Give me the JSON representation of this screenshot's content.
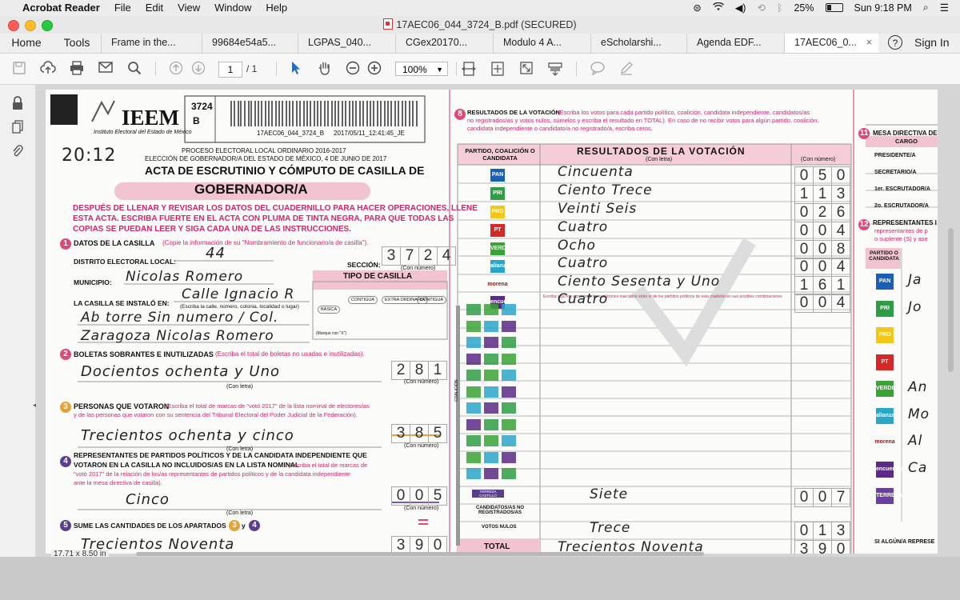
{
  "menubar": {
    "app": "Acrobat Reader",
    "items": [
      "File",
      "Edit",
      "View",
      "Window",
      "Help"
    ],
    "battery": "25%",
    "clock": "Sun 9:18 PM"
  },
  "window": {
    "title": "17AEC06_044_3724_B.pdf (SECURED)"
  },
  "tabs": {
    "home": "Home",
    "tools": "Tools",
    "items": [
      "Frame in the...",
      "99684e54a5...",
      "LGPAS_040...",
      "CGex20170...",
      "Modulo 4 A...",
      "eScholarshi...",
      "Agenda EDF...",
      "17AEC06_0..."
    ],
    "signin": "Sign In"
  },
  "toolbar": {
    "page_current": "1",
    "page_total": "/ 1",
    "zoom": "100%"
  },
  "status": {
    "page_size": "17.71 x 8.50 in"
  },
  "doc": {
    "barcode_num": "3724",
    "barcode_letter": "B",
    "barcode_text": "17AEC06_044_3724_B",
    "barcode_time": "2017/05/11_12:41:45_JE",
    "org_name": "IEEM",
    "org_sub": "Instituto Electoral del Estado de México",
    "time_hw": "20:12",
    "process": "PROCESO ELECTORAL LOCAL ORDINARIO 2016-2017",
    "election": "ELECCIÓN DE GOBERNADOR/A DEL ESTADO DE MÉXICO, 4 DE JUNIO DE 2017",
    "acta_title": "ACTA DE ESCRUTINIO Y CÓMPUTO DE CASILLA DE",
    "banner": "GOBERNADOR/A",
    "instr1": "DESPUÉS DE LLENAR Y REVISAR LOS DATOS DEL CUADERNILLO PARA HACER OPERACIONES, LLENE",
    "instr2": "ESTA ACTA.  ESCRIBA FUERTE EN EL ACTA CON PLUMA DE TINTA NEGRA, PARA QUE TODAS LAS",
    "instr3": "COPIAS SE PUEDAN LEER Y SIGA CADA UNA DE LAS INSTRUCCIONES.",
    "s1_title": "DATOS DE LA CASILLA",
    "s1_hint": "(Copie la información de su \"Nombramiento de funcionario/a de casilla\").",
    "distrito_label": "DISTRITO ELECTORAL LOCAL:",
    "distrito_hw": "44",
    "seccion_label": "SECCIÓN:",
    "seccion_digits": [
      "3",
      "7",
      "2",
      "4"
    ],
    "con_numero": "(Con número)",
    "municipio_label": "MUNICIPIO:",
    "municipio_hw": "Nicolas  Romero",
    "tipo_title": "TIPO DE CASILLA",
    "tipo_opts": [
      "BÁSICA",
      "CONTIGUA",
      "EXTRA ORDINARIA",
      "CONTIGUA"
    ],
    "instalo_label": "LA CASILLA SE INSTALÓ EN:",
    "instalo_hw1": "Calle Ignacio R",
    "instalo_hint": "(Escriba la calle, número, colonia, localidad o lugar)",
    "instalo_hw2": "Ab torre  Sin numero / Col.",
    "instalo_hw3": "Zaragoza  Nicolas Romero",
    "marque": "(Marque con \"X\")",
    "s2_title": "BOLETAS SOBRANTES E INUTILIZADAS",
    "s2_hint": "(Escriba el total de boletas no usadas e inutilizadas).",
    "s2_hw": "Docientos  ochenta y  Uno",
    "s2_digits": [
      "2",
      "8",
      "1"
    ],
    "con_letra": "(Con letra)",
    "s3_title": "PERSONAS QUE VOTARON",
    "s3_hint1": "(Escriba el total de marcas de \"votó 2017\" de la lista nominal de electores/as",
    "s3_hint2": "y de las personas que votaron con su sentencia del Tribunal Electoral del Poder Judicial de la Federación).",
    "s3_hw": "Trecientos  ochenta y  cinco",
    "s3_digits": [
      "3",
      "8",
      "5"
    ],
    "s4_title1": "REPRESENTANTES DE PARTIDOS POLÍTICOS Y DE LA CANDIDATA INDEPENDIENTE QUE",
    "s4_title2": "VOTARON EN LA CASILLA NO INCLUIDOS/AS EN LA LISTA NOMINAL",
    "s4_hint1": "(Escriba el total de marcas de",
    "s4_hint2": "\"votó 2017\" de la relación de los/as representantes de partidos políticos y de la candidata independiente",
    "s4_hint3": "ante la mesa directiva de casilla).",
    "s4_hw": "Cinco",
    "s4_digits": [
      "0",
      "0",
      "5"
    ],
    "s5_title": "SUME LAS CANTIDADES DE LOS APARTADOS",
    "s5_digits": [
      "3",
      "9",
      "0"
    ],
    "s5_hw": "Trecientos  Noventa",
    "equals": "=",
    "y": "y",
    "s8_title": "RESULTADOS DE LA VOTACIÓN",
    "s8_hint1": "(Escriba los votos para cada partido político, coalición, candidata independiente, candidatos/as",
    "s8_hint2": "no registrados/as y votos nulos, súmelos y escriba el resultado en TOTAL). En caso de no recibir votos para algún partido, coalición,",
    "s8_hint3": "candidata  independiente o candidato/a no registrado/a, escriba ceros.",
    "col_partido": "PARTIDO, COALICIÓN O CANDIDATA",
    "col_resultados": "RESULTADOS DE LA VOTACIÓN",
    "col_letra": "(Con letra)",
    "col_numero": "(Con número)",
    "results": [
      {
        "party": "PAN",
        "color": "#1a5fb4",
        "words": "Cincuenta",
        "digits": [
          "0",
          "5",
          "0"
        ]
      },
      {
        "party": "PRI",
        "color": "#2e9e44",
        "words": "Ciento  Trece",
        "digits": [
          "1",
          "1",
          "3"
        ]
      },
      {
        "party": "PRD",
        "color": "#f5c518",
        "words": "Veinti  Seis",
        "digits": [
          "0",
          "2",
          "6"
        ]
      },
      {
        "party": "PT",
        "color": "#d62828",
        "words": "Cuatro",
        "digits": [
          "0",
          "0",
          "4"
        ]
      },
      {
        "party": "VERDE",
        "color": "#3aa335",
        "words": "Ocho",
        "digits": [
          "0",
          "0",
          "8"
        ]
      },
      {
        "party": "alianza",
        "color": "#2aa6c9",
        "words": "Cuatro",
        "digits": [
          "0",
          "0",
          "4"
        ]
      },
      {
        "party": "morena",
        "color": "#8b1a1a",
        "words": "Ciento  Sesenta y  Uno",
        "digits": [
          "1",
          "6",
          "1"
        ]
      },
      {
        "party": "encuentro",
        "color": "#5b2a86",
        "words": "Cuatro",
        "digits": [
          "0",
          "0",
          "4"
        ]
      }
    ],
    "coalicion_note": "Escriba aquí los votos para las coaliciones marcados entre sí de los partidos políticos de esta coalición en sus posibles combinaciones",
    "coalicion_label": "COALICIÓN",
    "terreza_label": "TERREZA CASTILLO",
    "terreza_words": "Siete",
    "terreza_digits": [
      "0",
      "0",
      "7"
    ],
    "no_reg_label": "CANDIDATOS/AS NO REGISTRADOS/AS",
    "nulos_label": "VOTOS NULOS",
    "nulos_words": "Trece",
    "nulos_digits": [
      "0",
      "1",
      "3"
    ],
    "total_label": "TOTAL",
    "total_words": "Trecientos  Noventa",
    "total_digits": [
      "3",
      "9",
      "0"
    ],
    "s11_title": "MESA DIRECTIVA DE",
    "s11_cargo": "CARGO",
    "s11_roles": [
      "PRESIDENTE/A",
      "SECRETARIO/A",
      "1er. ESCRUTADOR/A",
      "2o. ESCRUTADOR/A"
    ],
    "s12_title": "REPRESENTANTES I",
    "s12_hint1": "representantes de p",
    "s12_hint2": "o suplente (S) y ase",
    "s12_col": "PARTIDO O CANDIDATA",
    "s12_parties": [
      {
        "name": "PAN",
        "color": "#1a5fb4",
        "hw": "Ja"
      },
      {
        "name": "PRI",
        "color": "#2e9e44",
        "hw": "Jo"
      },
      {
        "name": "PRD",
        "color": "#f5c518",
        "hw": ""
      },
      {
        "name": "PT",
        "color": "#d62828",
        "hw": ""
      },
      {
        "name": "VERDE",
        "color": "#3aa335",
        "hw": "An"
      },
      {
        "name": "alianza",
        "color": "#2aa6c9",
        "hw": "Mo"
      },
      {
        "name": "morena",
        "color": "#8b1a1a",
        "hw": "Al"
      },
      {
        "name": "encuentro",
        "color": "#5b2a86",
        "hw": "Ca"
      },
      {
        "name": "TERREZA",
        "color": "#6b3fa0",
        "hw": ""
      }
    ],
    "s12_footer": "SI ALGÚN/A REPRESE"
  }
}
